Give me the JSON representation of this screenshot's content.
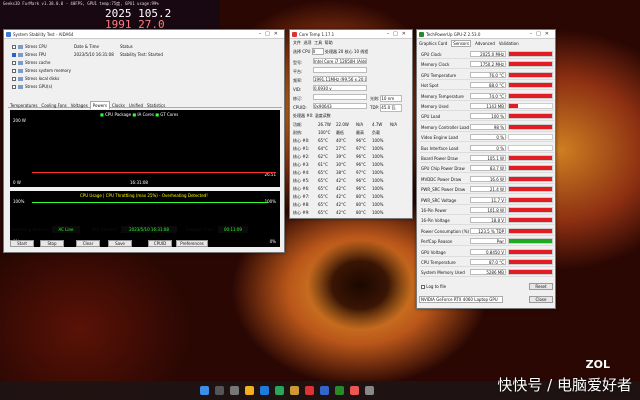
{
  "desktop": {
    "watermark": "快快号 / 电脑爱好者",
    "brand": "ZOL",
    "hud": {
      "title": "Geeks3D FurMark v1.38.0.0 - 40FPS, GPU1 temp:75度, GPU1 usage:99%",
      "line1": "2025 105.2",
      "line2": "1991 27.0"
    }
  },
  "aida": {
    "title": "System Stability Test - AIDA64",
    "checks": [
      {
        "label": "Stress CPU",
        "on": false
      },
      {
        "label": "Stress FPU",
        "on": true
      },
      {
        "label": "Stress cache",
        "on": false
      },
      {
        "label": "Stress system memory",
        "on": false
      },
      {
        "label": "Stress local disks",
        "on": false
      },
      {
        "label": "Stress GPU(s)",
        "on": false
      }
    ],
    "kv": [
      {
        "k": "Date & Time",
        "v": "Status"
      },
      {
        "k": "2023/5/10 16:31:08",
        "v": "Stability Test: Started"
      }
    ],
    "tabs": [
      "Temperatures",
      "Cooling Fans",
      "Voltages",
      "Powers",
      "Clocks",
      "Unified",
      "Statistics"
    ],
    "g1": {
      "legend": [
        "CPU Package",
        "IA Cores",
        "GT Cores"
      ],
      "ymax": "200 W",
      "ymin": "0 W",
      "time": "16:31:08",
      "val": "26.51"
    },
    "g2": {
      "legend": "CPU Usage | CPU Throttling (max 25%) - Overheating Detected!",
      "ymax": "100%",
      "ymin": "0%",
      "r1": "100%",
      "r2": "0%"
    },
    "status": {
      "batt_label": "Remaining Battery:",
      "batt": "AC Line",
      "start_label": "Test Started:",
      "start": "2023/5/10 16:31:08",
      "elapsed_label": "Elapsed Time:",
      "elapsed": "00:11:09"
    },
    "buttons": [
      "Start",
      "Stop",
      "Clear",
      "Save",
      "CPUID",
      "Preferences"
    ]
  },
  "coretemp": {
    "title": "Core Temp 1.17.1",
    "menu": [
      "文件",
      "选项",
      "工具",
      "帮助"
    ],
    "top": {
      "sel_label": "选择 CPU",
      "sel": "0",
      "proc_label": "处理器",
      "cores": "20 核心",
      "threads": "10 线程"
    },
    "info": [
      {
        "k": "型号:",
        "v": "Intel Core i7 12650H (Alder Lake-P)"
      },
      {
        "k": "平台:",
        "v": ""
      },
      {
        "k": "频率:",
        "v": "1991.11MHz (99.56 x 20.0)"
      },
      {
        "k": "VID:",
        "v": "0.6930 v"
      },
      {
        "k": "修订:",
        "v": "",
        "k2": "光刻:",
        "v2": "10 nm"
      },
      {
        "k": "CPUID:",
        "v": "0x90643",
        "k2": "TDP:",
        "v2": "45.0 瓦"
      }
    ],
    "section": "处理器 #0: 温度读数",
    "head": [
      "功耗:",
      "26.7W",
      "22.0W",
      "N/A",
      "4.7W",
      "N/A"
    ],
    "head2": [
      "耐热:",
      "100°C",
      "最低",
      "最高",
      "负载"
    ],
    "cores": [
      {
        "n": "核心 #0:",
        "t": "65°C",
        "mn": "40°C",
        "mx": "96°C",
        "ld": "100%"
      },
      {
        "n": "核心 #1:",
        "t": "64°C",
        "mn": "27°C",
        "mx": "97°C",
        "ld": "100%"
      },
      {
        "n": "核心 #2:",
        "t": "62°C",
        "mn": "39°C",
        "mx": "96°C",
        "ld": "100%"
      },
      {
        "n": "核心 #3:",
        "t": "61°C",
        "mn": "30°C",
        "mx": "96°C",
        "ld": "100%"
      },
      {
        "n": "核心 #4:",
        "t": "65°C",
        "mn": "38°C",
        "mx": "97°C",
        "ld": "100%"
      },
      {
        "n": "核心 #5:",
        "t": "65°C",
        "mn": "42°C",
        "mx": "96°C",
        "ld": "100%"
      },
      {
        "n": "核心 #6:",
        "t": "65°C",
        "mn": "42°C",
        "mx": "96°C",
        "ld": "100%"
      },
      {
        "n": "核心 #7:",
        "t": "65°C",
        "mn": "42°C",
        "mx": "80°C",
        "ld": "100%"
      },
      {
        "n": "核心 #8:",
        "t": "65°C",
        "mn": "42°C",
        "mx": "80°C",
        "ld": "100%"
      },
      {
        "n": "核心 #9:",
        "t": "65°C",
        "mn": "42°C",
        "mx": "80°C",
        "ld": "100%"
      }
    ]
  },
  "gpuz": {
    "title": "TechPowerUp GPU-Z 2.53.0",
    "tabs": [
      "Graphics Card",
      "Sensors",
      "Advanced",
      "Validation"
    ],
    "sensors": [
      {
        "n": "GPU Clock",
        "v": "2025.0 MHz",
        "p": 1
      },
      {
        "n": "Memory Clock",
        "v": "1750.2 MHz",
        "p": 1
      },
      {
        "n": "GPU Temperature",
        "v": "76.0 °C",
        "p": 1
      },
      {
        "n": "Hot Spot",
        "v": "88.0 °C",
        "p": 1
      },
      {
        "n": "Memory Temperature",
        "v": "74.0 °C",
        "p": 1
      },
      {
        "n": "Memory Used",
        "v": "1143 MB",
        "p": 0.2
      },
      {
        "n": "GPU Load",
        "v": "100 %",
        "p": 1
      },
      {
        "n": "Memory Controller Load",
        "v": "98 %",
        "p": 1
      },
      {
        "n": "Video Engine Load",
        "v": "0 %",
        "p": 0
      },
      {
        "n": "Bus Interface Load",
        "v": "0 %",
        "p": 0
      },
      {
        "n": "Board Power Draw",
        "v": "105.1 W",
        "p": 1
      },
      {
        "n": "GPU Chip Power Draw",
        "v": "83.7 W",
        "p": 1
      },
      {
        "n": "MVDDC Power Draw",
        "v": "16.6 W",
        "p": 1
      },
      {
        "n": "PWR_SRC Power Draw",
        "v": "21.4 W",
        "p": 1
      },
      {
        "n": "PWR_SRC Voltage",
        "v": "11.7 V",
        "p": 1
      },
      {
        "n": "16-Pin Power",
        "v": "101.8 W",
        "p": 1
      },
      {
        "n": "16-Pin Voltage",
        "v": "18.8 V",
        "p": 1
      },
      {
        "n": "Power Consumption (%)",
        "v": "123.5 % TDP",
        "p": 1
      },
      {
        "n": "PerfCap Reason",
        "v": "Pwr",
        "p": 1,
        "green": true
      },
      {
        "n": "GPU Voltage",
        "v": "0.8450 V",
        "p": 1
      },
      {
        "n": "CPU Temperature",
        "v": "87.0 °C",
        "p": 1
      },
      {
        "n": "System Memory Used",
        "v": "5286 MB",
        "p": 1
      }
    ],
    "log": "Log to file",
    "reset": "Reset",
    "card": "NVIDIA GeForce RTX 4060 Laptop GPU",
    "close": "Close"
  },
  "colors": {
    "accent": "#e31b23",
    "graph_line": "#ff2020",
    "ok": "#1fa81f"
  }
}
